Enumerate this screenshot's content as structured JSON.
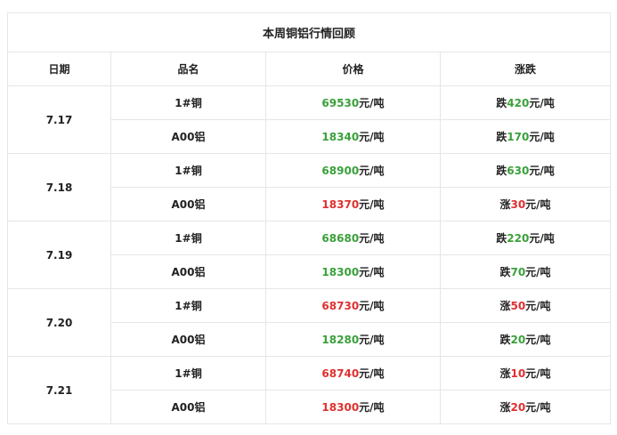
{
  "title": "本周铜铝行情回顾",
  "headers": [
    "日期",
    "品名",
    "价格",
    "涨跌"
  ],
  "unit": "元/吨",
  "colors": {
    "up": "#e03030",
    "down": "#3aa03a"
  },
  "groups": [
    {
      "date": "7.17",
      "rows": [
        {
          "product": "1#铜",
          "price": "69530",
          "price_dir": "down",
          "change_word": "跌",
          "change": "420",
          "change_dir": "down"
        },
        {
          "product": "A00铝",
          "price": "18340",
          "price_dir": "down",
          "change_word": "跌",
          "change": "170",
          "change_dir": "down"
        }
      ]
    },
    {
      "date": "7.18",
      "rows": [
        {
          "product": "1#铜",
          "price": "68900",
          "price_dir": "down",
          "change_word": "跌",
          "change": "630",
          "change_dir": "down"
        },
        {
          "product": "A00铝",
          "price": "18370",
          "price_dir": "up",
          "change_word": "涨",
          "change": "30",
          "change_dir": "up"
        }
      ]
    },
    {
      "date": "7.19",
      "rows": [
        {
          "product": "1#铜",
          "price": "68680",
          "price_dir": "down",
          "change_word": "跌",
          "change": "220",
          "change_dir": "down"
        },
        {
          "product": "A00铝",
          "price": "18300",
          "price_dir": "down",
          "change_word": "跌",
          "change": "70",
          "change_dir": "down"
        }
      ]
    },
    {
      "date": "7.20",
      "rows": [
        {
          "product": "1#铜",
          "price": "68730",
          "price_dir": "up",
          "change_word": "涨",
          "change": "50",
          "change_dir": "up"
        },
        {
          "product": "A00铝",
          "price": "18280",
          "price_dir": "down",
          "change_word": "跌",
          "change": "20",
          "change_dir": "down"
        }
      ]
    },
    {
      "date": "7.21",
      "rows": [
        {
          "product": "1#铜",
          "price": "68740",
          "price_dir": "up",
          "change_word": "涨",
          "change": "10",
          "change_dir": "up"
        },
        {
          "product": "A00铝",
          "price": "18300",
          "price_dir": "up",
          "change_word": "涨",
          "change": "20",
          "change_dir": "up"
        }
      ]
    }
  ]
}
